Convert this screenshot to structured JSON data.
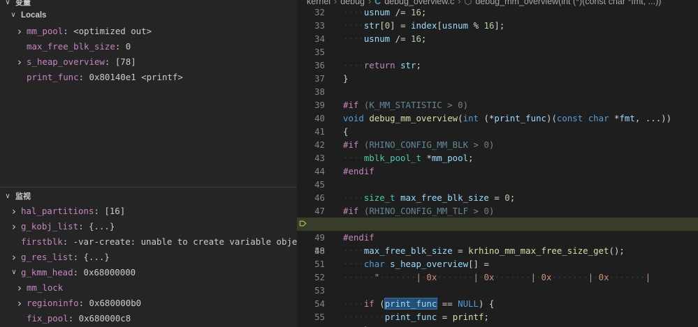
{
  "variables": {
    "section_title": "变量",
    "locals_label": "Locals",
    "items": [
      {
        "name": "mm_pool",
        "value": "<optimized out>",
        "expandable": true
      },
      {
        "name": "max_free_blk_size",
        "value": "0",
        "expandable": false
      },
      {
        "name": "s_heap_overview",
        "value": "[78]",
        "expandable": true
      },
      {
        "name": "print_func",
        "value": "0x80140e1 <printf>",
        "expandable": false
      }
    ]
  },
  "watch": {
    "section_title": "监视",
    "items": [
      {
        "name": "hal_partitions",
        "value": "[16]",
        "expandable": true,
        "level": 0
      },
      {
        "name": "g_kobj_list",
        "value": "{...}",
        "expandable": true,
        "level": 0
      },
      {
        "name": "firstblk",
        "value": "-var-create: unable to create variable object",
        "expandable": false,
        "level": 0
      },
      {
        "name": "g_res_list",
        "value": "{...}",
        "expandable": true,
        "level": 0
      },
      {
        "name": "g_kmm_head",
        "value": "0x68000000",
        "expandable": true,
        "expanded": true,
        "level": 0
      },
      {
        "name": "mm_lock",
        "value": "",
        "expandable": true,
        "level": 1
      },
      {
        "name": "regioninfo",
        "value": "0x680000b0",
        "expandable": true,
        "level": 1
      },
      {
        "name": "fix_pool",
        "value": "0x680000c8",
        "expandable": false,
        "level": 1
      }
    ]
  },
  "breadcrumb": {
    "items": [
      "kernel",
      "debug",
      "debug_overview.c",
      "debug_mm_overview(int (*)(const char *fmt, ...))"
    ]
  },
  "editor": {
    "current_line": "48",
    "line_numbers": [
      "32",
      "33",
      "34",
      "35",
      "36",
      "37",
      "38",
      "39",
      "40",
      "41",
      "42",
      "43",
      "44",
      "45",
      "46",
      "47",
      "48",
      "49",
      "50",
      "51",
      "52",
      "53",
      "54",
      "55",
      "56"
    ]
  },
  "colors": {
    "current_line_bg": "#373d29",
    "breakpoint": "#8bc34a",
    "selection": "#264f78"
  }
}
